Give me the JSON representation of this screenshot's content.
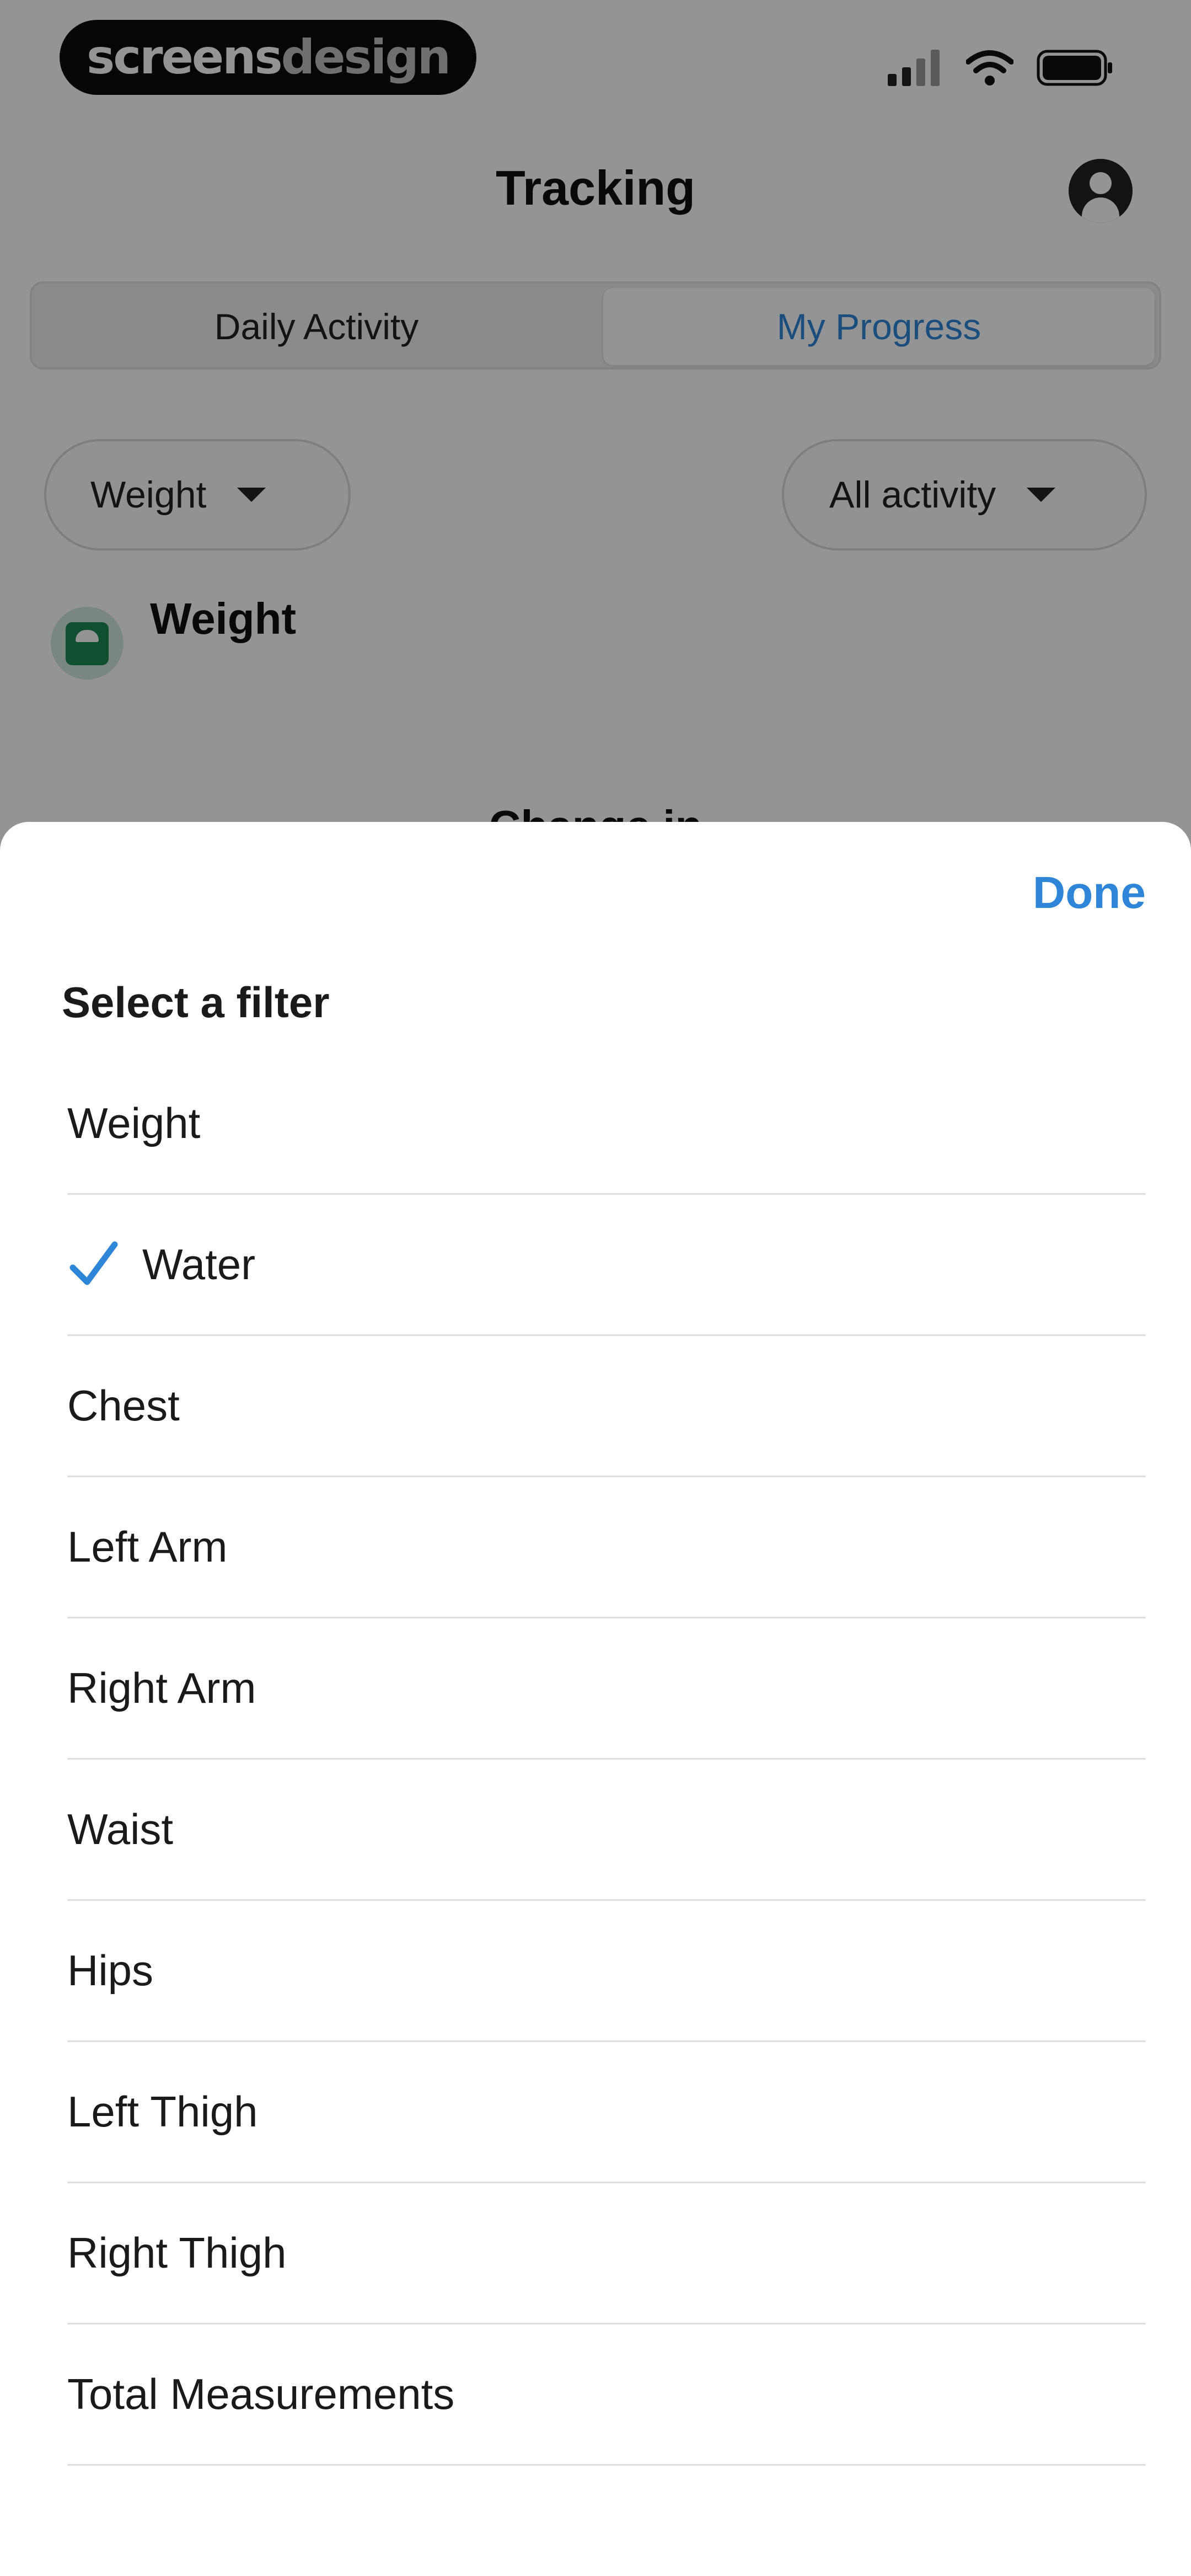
{
  "status_bar": {
    "logo_part1": "screens",
    "logo_part2": "design",
    "icons": [
      "signal-icon",
      "wifi-icon",
      "battery-icon"
    ]
  },
  "header": {
    "title": "Tracking"
  },
  "tabs": [
    {
      "label": "Daily Activity",
      "active": false
    },
    {
      "label": "My Progress",
      "active": true
    }
  ],
  "filters": {
    "metric": "Weight",
    "range": "All activity"
  },
  "section": {
    "title": "Weight",
    "chart_label": "Change in"
  },
  "sheet": {
    "done_label": "Done",
    "title": "Select a filter",
    "selected_index": 1,
    "options": [
      "Weight",
      "Water",
      "Chest",
      "Left Arm",
      "Right Arm",
      "Waist",
      "Hips",
      "Left Thigh",
      "Right Thigh",
      "Total Measurements"
    ]
  },
  "colors": {
    "accent": "#2f86d8",
    "scale_green": "#1c8a55",
    "overlay": "rgba(0,0,0,0.42)"
  }
}
